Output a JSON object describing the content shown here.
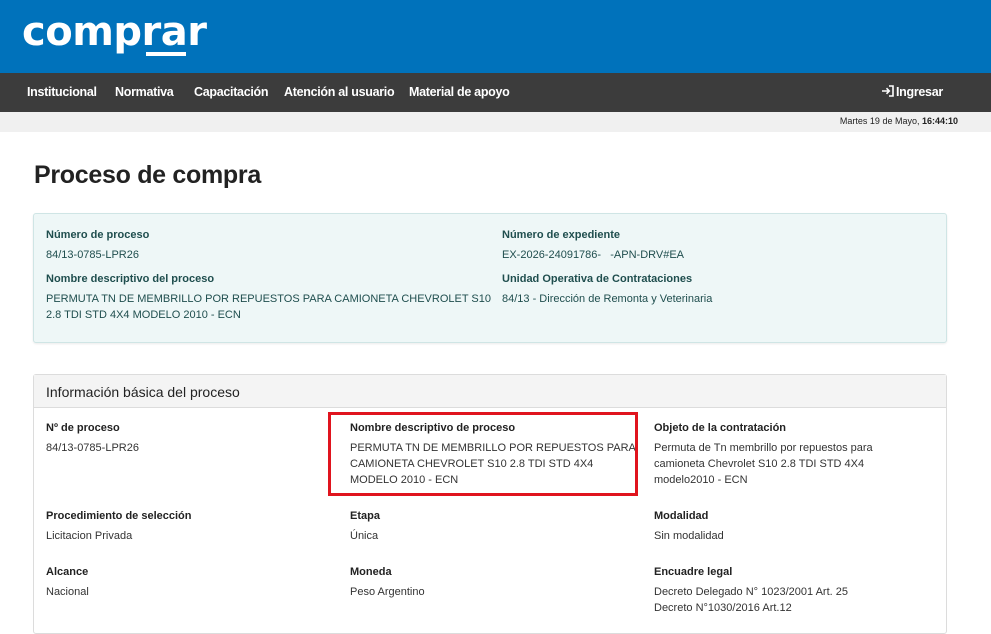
{
  "brand": {
    "name": "comprar"
  },
  "nav": {
    "items": [
      "Institucional",
      "Normativa",
      "Capacitación",
      "Atención al usuario",
      "Material de apoyo"
    ],
    "login": "Ingresar"
  },
  "datebar": {
    "date": "Martes 19 de Mayo, ",
    "time": "16:44:10"
  },
  "page": {
    "title": "Proceso de compra"
  },
  "summary": {
    "numero_proceso_label": "Número de proceso",
    "numero_proceso": "84/13-0785-LPR26",
    "numero_expediente_label": "Número de expediente",
    "numero_expediente": "EX-2026-24091786-   -APN-DRV#EA",
    "nombre_label": "Nombre descriptivo del proceso",
    "nombre_line1": "PERMUTA TN DE MEMBRILLO POR REPUESTOS PARA CAMIONETA CHEVROLET S10",
    "nombre_line2": "2.8 TDI STD 4X4 MODELO 2010 - ECN",
    "unidad_label": "Unidad Operativa de Contrataciones",
    "unidad": "84/13 - Dirección de Remonta y Veterinaria"
  },
  "panel": {
    "title": "Información básica del proceso",
    "fields": {
      "nro_label": "Nº de proceso",
      "nro": "84/13-0785-LPR26",
      "nombre_label": "Nombre descriptivo de proceso",
      "nombre_line1": "PERMUTA TN DE MEMBRILLO POR REPUESTOS PARA",
      "nombre_line2": "CAMIONETA CHEVROLET S10 2.8 TDI STD 4X4",
      "nombre_line3": "MODELO 2010 - ECN",
      "objeto_label": "Objeto de la contratación",
      "objeto_line1": "Permuta de Tn membrillo por repuestos para",
      "objeto_line2": "camioneta Chevrolet S10 2.8 TDI STD 4X4",
      "objeto_line3": "modelo2010 - ECN",
      "procedimiento_label": "Procedimiento de selección",
      "procedimiento": "Licitacion Privada",
      "etapa_label": "Etapa",
      "etapa": "Única",
      "modalidad_label": "Modalidad",
      "modalidad": "Sin modalidad",
      "alcance_label": "Alcance",
      "alcance": "Nacional",
      "moneda_label": "Moneda",
      "moneda": "Peso Argentino",
      "encuadre_label": "Encuadre legal",
      "encuadre_line1": "Decreto Delegado N° 1023/2001 Art. 25",
      "encuadre_line2": "Decreto N°1030/2016 Art.12"
    }
  },
  "colors": {
    "brand_blue": "#0072bb",
    "nav_bg": "#3c3c3c",
    "highlight": "#e0141e",
    "summary_bg": "#eef7f7"
  }
}
